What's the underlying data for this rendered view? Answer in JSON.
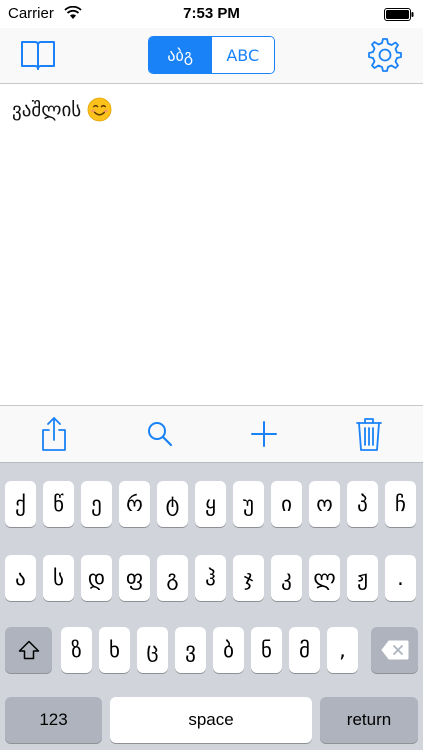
{
  "status_bar": {
    "carrier": "Carrier",
    "time": "7:53 PM"
  },
  "nav": {
    "segment_active": "აბგ",
    "segment_inactive": "ABC",
    "left_icon": "book-icon",
    "right_icon": "gear-icon"
  },
  "editor": {
    "text": "ვაშლის",
    "emoji": "smiling-face"
  },
  "toolbar": {
    "icons": [
      "share-icon",
      "search-icon",
      "plus-icon",
      "trash-icon"
    ]
  },
  "keyboard": {
    "row1": [
      "ქ",
      "წ",
      "ე",
      "რ",
      "ტ",
      "ყ",
      "უ",
      "ი",
      "ო",
      "პ",
      "ჩ"
    ],
    "row2": [
      "ა",
      "ს",
      "დ",
      "ფ",
      "გ",
      "ჰ",
      "ჯ",
      "კ",
      "ლ",
      "ჟ",
      "."
    ],
    "row3": [
      "ზ",
      "ხ",
      "ც",
      "ვ",
      "ბ",
      "ნ",
      "მ",
      ","
    ],
    "numbers_label": "123",
    "space_label": "space",
    "return_label": "return"
  },
  "colors": {
    "accent": "#1a82f7",
    "keyboard_bg": "#d1d5db",
    "dark_key": "#aeb3be"
  }
}
